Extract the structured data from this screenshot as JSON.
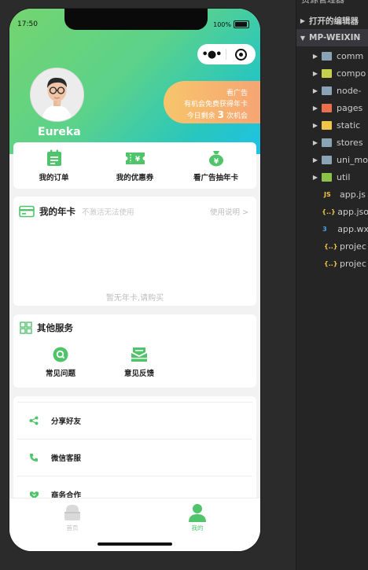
{
  "ide": {
    "explorer_label": "资源管理器",
    "open_editors": "打开的编辑器",
    "project": "MP-WEIXIN",
    "folders": [
      {
        "name": "comm",
        "color": "#8aa4b5"
      },
      {
        "name": "compo",
        "color": "#c5d04d"
      },
      {
        "name": "node-",
        "color": "#8aa4b5"
      },
      {
        "name": "pages",
        "color": "#e8704f"
      },
      {
        "name": "static",
        "color": "#f0c54a"
      },
      {
        "name": "stores",
        "color": "#8aa4b5"
      },
      {
        "name": "uni_mo",
        "color": "#8aa4b5"
      },
      {
        "name": "util",
        "color": "#8bc34a"
      }
    ],
    "files": [
      {
        "name": "app.js",
        "icon": "js-icon",
        "tag": "JS",
        "color": "#f0c54a"
      },
      {
        "name": "app.jso",
        "icon": "json-icon",
        "tag": "{..}",
        "color": "#f0c54a"
      },
      {
        "name": "app.wx",
        "icon": "css-icon",
        "tag": "3",
        "color": "#42a5f5"
      },
      {
        "name": "projec",
        "icon": "json-icon",
        "tag": "{..}",
        "color": "#f0c54a"
      },
      {
        "name": "projec",
        "icon": "json-icon",
        "tag": "{..}",
        "color": "#f0c54a"
      }
    ]
  },
  "status": {
    "time": "17:50",
    "battery": "100%"
  },
  "profile": {
    "username": "Eureka"
  },
  "ad": {
    "line1": "看广告",
    "line2": "有机会免费获得年卡",
    "prefix": "今日剩余",
    "count": "3",
    "suffix": "次机会"
  },
  "quick_actions": [
    {
      "label": "我的订单",
      "icon": "order-icon"
    },
    {
      "label": "我的优惠券",
      "icon": "coupon-icon"
    },
    {
      "label": "看广告抽年卡",
      "icon": "money-bag-icon"
    }
  ],
  "year_card": {
    "title": "我的年卡",
    "subtitle": "不激活无法使用",
    "help": "使用说明 >",
    "empty": "暂无年卡,请购买"
  },
  "services": {
    "title": "其他服务",
    "items": [
      {
        "label": "常见问题",
        "icon": "faq-icon"
      },
      {
        "label": "意见反馈",
        "icon": "feedback-icon"
      }
    ]
  },
  "menu": [
    {
      "label": "分享好友",
      "icon": "share-icon"
    },
    {
      "label": "微信客服",
      "icon": "phone-icon"
    },
    {
      "label": "商务合作",
      "icon": "handshake-icon"
    }
  ],
  "tabs": [
    {
      "label": "首页",
      "icon": "home-icon",
      "active": false
    },
    {
      "label": "我的",
      "icon": "user-icon",
      "active": true
    }
  ],
  "colors": {
    "accent": "#4fc46a",
    "inactive": "#bdbdbd"
  }
}
